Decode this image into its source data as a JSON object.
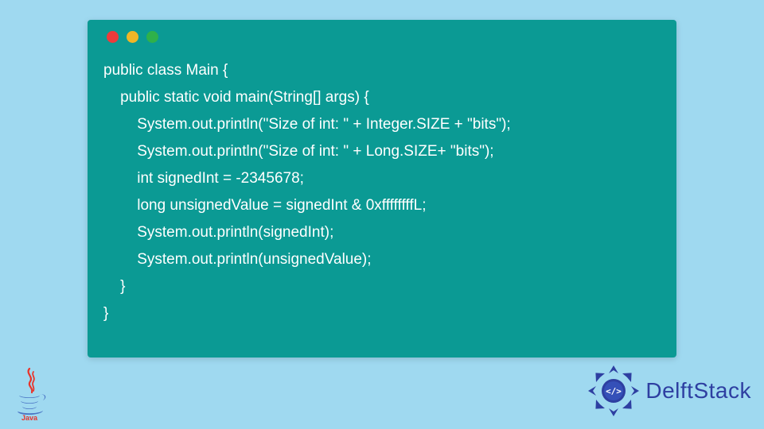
{
  "code": {
    "lines": [
      "public class Main {",
      "    public static void main(String[] args) {",
      "        System.out.println(\"Size of int: \" + Integer.SIZE + \"bits\");",
      "        System.out.println(\"Size of int: \" + Long.SIZE+ \"bits\");",
      "        int signedInt = -2345678;",
      "        long unsignedValue = signedInt & 0xffffffffL;",
      "        System.out.println(signedInt);",
      "        System.out.println(unsignedValue);",
      "    }",
      "}"
    ]
  },
  "branding": {
    "java_label": "Java",
    "delftstack_label": "DelftStack"
  },
  "colors": {
    "page_bg": "#9fd9f0",
    "window_bg": "#0b9a94",
    "code_text": "#ffffff",
    "dot_red": "#ed3b3b",
    "dot_yellow": "#f0b627",
    "dot_green": "#2fb14a",
    "brand_blue": "#2e3fa1"
  }
}
